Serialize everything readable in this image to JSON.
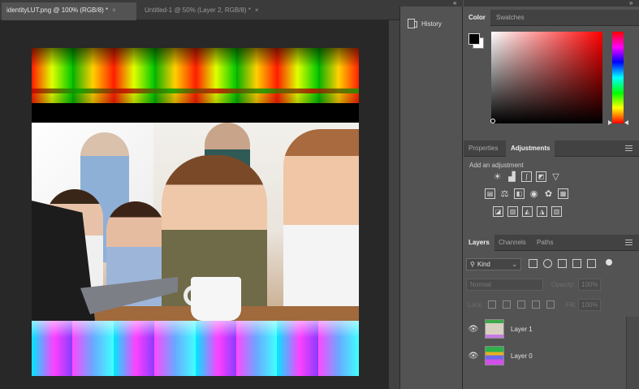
{
  "document_tabs": [
    {
      "label": "identityLUT.png @ 100% (RGB/8) *",
      "close": "×"
    },
    {
      "label": "Untitled-1 @ 50% (Layer 2, RGB/8) *",
      "close": "×"
    }
  ],
  "collapse": {
    "left": "»",
    "history_collapse": "«",
    "right": "»"
  },
  "history": {
    "label": "History"
  },
  "color_panel": {
    "tabs": [
      "Color",
      "Swatches"
    ],
    "foreground": "#000000",
    "background": "#ffffff"
  },
  "adjustments_panel": {
    "tabs": [
      "Properties",
      "Adjustments"
    ],
    "prompt": "Add an adjustment",
    "icons_row1": [
      "brightness-icon",
      "levels-icon",
      "curves-icon",
      "exposure-icon",
      "vibrance-icon"
    ],
    "icons_row2": [
      "hue-saturation-icon",
      "color-balance-icon",
      "black-white-icon",
      "photo-filter-icon",
      "channel-mixer-icon",
      "color-lookup-icon"
    ],
    "icons_row3": [
      "invert-icon",
      "posterize-icon",
      "threshold-icon",
      "selective-color-icon",
      "gradient-map-icon"
    ]
  },
  "layers_panel": {
    "tabs": [
      "Layers",
      "Channels",
      "Paths"
    ],
    "filter_kind": "Kind",
    "blend_mode": "Normal",
    "opacity_label": "Opacity:",
    "opacity_value": "100%",
    "lock_label": "Lock:",
    "fill_label": "Fill:",
    "fill_value": "100%",
    "layers": [
      {
        "name": "Layer 1"
      },
      {
        "name": "Layer 0"
      }
    ]
  }
}
